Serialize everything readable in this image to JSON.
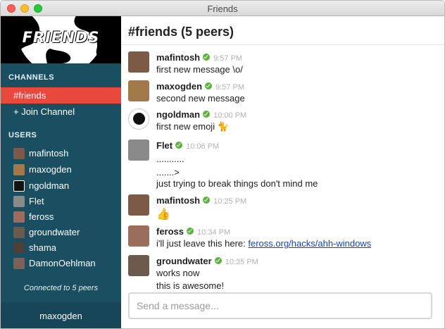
{
  "window": {
    "title": "Friends"
  },
  "sidebar": {
    "logo_text": "FRIENDS",
    "channels_heading": "CHANNELS",
    "channels": [
      {
        "label": "#friends",
        "active": true
      },
      {
        "label": "+ Join Channel",
        "active": false
      }
    ],
    "users_heading": "USERS",
    "users": [
      {
        "name": "mafintosh",
        "avatar_color": "#7d5a46"
      },
      {
        "name": "maxogden",
        "avatar_color": "#a27a4a"
      },
      {
        "name": "ngoldman",
        "avatar_color": "#111111"
      },
      {
        "name": "Flet",
        "avatar_color": "#8a8a8a"
      },
      {
        "name": "feross",
        "avatar_color": "#9a6e5a"
      },
      {
        "name": "groundwater",
        "avatar_color": "#6e5a4d"
      },
      {
        "name": "shama",
        "avatar_color": "#4d3f39"
      },
      {
        "name": "DamonOehlman",
        "avatar_color": "#7b6156"
      }
    ],
    "connected_text": "Connected to 5 peers",
    "current_user": "maxogden"
  },
  "main": {
    "channel_title": "#friends (5 peers)",
    "messages": [
      {
        "author": "mafintosh",
        "time": "9:57 PM",
        "lines": [
          "first new message \\o/"
        ],
        "avatar_color": "#7d5a46"
      },
      {
        "author": "maxogden",
        "time": "9:57 PM",
        "lines": [
          "second new message"
        ],
        "avatar_color": "#a27a4a"
      },
      {
        "author": "ngoldman",
        "time": "10:00 PM",
        "lines": [
          "first new emoji 🐈"
        ],
        "avatar_color": "#111111"
      },
      {
        "author": "Flet",
        "time": "10:06 PM",
        "lines": [
          "...........",
          ".......>",
          "just trying to break things don't mind me"
        ],
        "avatar_color": "#8a8a8a"
      },
      {
        "author": "mafintosh",
        "time": "10:25 PM",
        "lines": [
          "👍"
        ],
        "avatar_color": "#7d5a46"
      },
      {
        "author": "feross",
        "time": "10:34 PM",
        "lines": [
          "i'll just leave this here: "
        ],
        "link": "feross.org/hacks/ahh-windows",
        "avatar_color": "#9a6e5a"
      },
      {
        "author": "groundwater",
        "time": "10:35 PM",
        "lines": [
          "works now",
          "this is awesome!"
        ],
        "avatar_color": "#6e5a4d"
      }
    ],
    "composer": {
      "placeholder": "Send a message...",
      "value": ""
    }
  }
}
